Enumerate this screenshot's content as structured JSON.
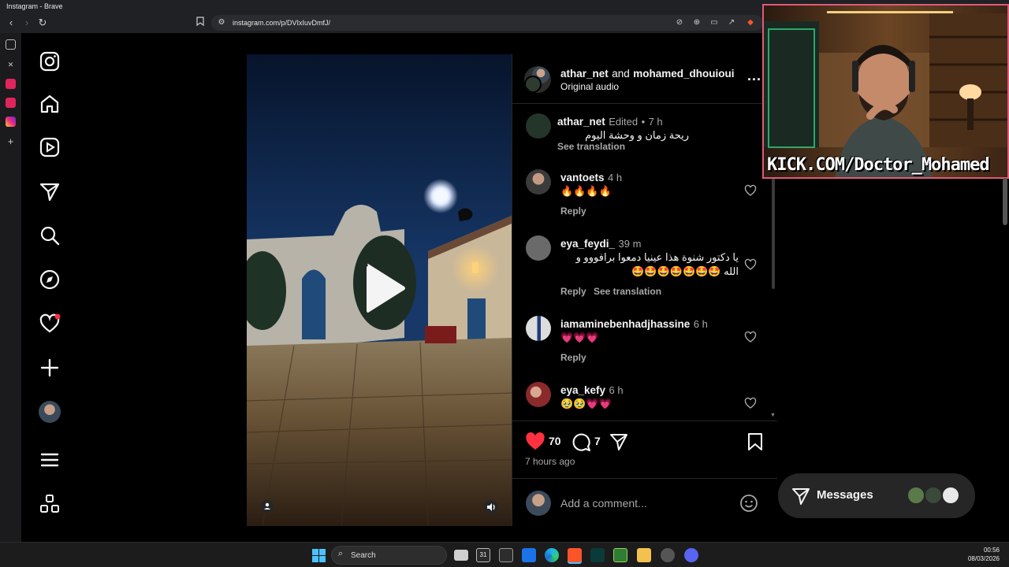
{
  "window": {
    "title": "Instagram - Brave"
  },
  "browser": {
    "url": "instagram.com/p/DVIxIuvDmfJ/"
  },
  "post": {
    "header": {
      "user1": "athar_net",
      "joiner": "and",
      "user2": "mohamed_dhouioui",
      "audio": "Original audio",
      "more_label": "..."
    },
    "caption": {
      "user": "athar_net",
      "edited": "Edited",
      "dot": "•",
      "time": "7 h",
      "text": "ريحة زمان و وحشة اليوم",
      "see_translation": "See translation"
    },
    "comments": [
      {
        "user": "vantoets",
        "time": "4 h",
        "text": "🔥🔥🔥🔥",
        "reply": "Reply"
      },
      {
        "user": "eya_feydi_",
        "time": "39 m",
        "text_line1": "يا دكتور شنوة هذا عينيا دمعوا برافووو و",
        "text_line2": "الله 🤩🤩🤩🤩🤩🤩🤩",
        "reply": "Reply",
        "see_translation": "See translation"
      },
      {
        "user": "iamaminebenhadjhassine",
        "time": "6 h",
        "text": "💗💗💗",
        "reply": "Reply"
      },
      {
        "user": "eya_kefy",
        "time": "6 h",
        "text": "🥹🥹💗💗"
      }
    ],
    "likes_count": "70",
    "comments_count": "7",
    "posted_ago": "7 hours ago",
    "add_comment_placeholder": "Add a comment..."
  },
  "messages": {
    "label": "Messages"
  },
  "stream": {
    "overlay_text": "KICK.COM/Doctor_Mohamed"
  },
  "taskbar": {
    "search_label": "Search",
    "time": "00:56",
    "date": "08/03/2026",
    "calendar_day": "31"
  },
  "colors": {
    "like_red": "#ff3040",
    "kick_green": "#53fc18",
    "cam_border": "#e05a78"
  }
}
